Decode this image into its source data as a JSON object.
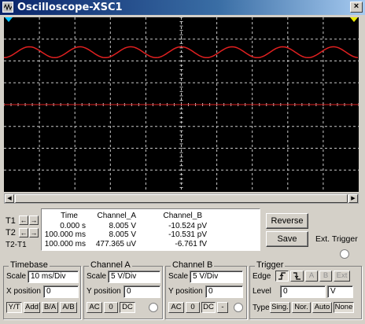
{
  "window": {
    "title": "Oscilloscope-XSC1",
    "close_label": "×"
  },
  "colors": {
    "trace_a": "#e02020",
    "grid": "#c8c8c8",
    "cursor_t1": "#00c0ff",
    "cursor_t2": "#e8e800"
  },
  "scope": {
    "sine": {
      "cycles_visible": 7,
      "amplitude_div": 0.25,
      "offset_div": 2.4
    },
    "baseline": {
      "offset_div": 0
    }
  },
  "cursors": {
    "t1_label": "T1",
    "t2_label": "T2",
    "diff_label": "T2-T1",
    "arrow_left": "←",
    "arrow_right": "→"
  },
  "readout": {
    "headers": [
      "Time",
      "Channel_A",
      "Channel_B"
    ],
    "rows": [
      [
        "0.000 s",
        "8.005 V",
        "-10.524 pV"
      ],
      [
        "100.000 ms",
        "8.005 V",
        "-10.531 pV"
      ],
      [
        "100.000 ms",
        "477.365 uV",
        "-6.761 fV"
      ]
    ]
  },
  "buttons": {
    "reverse": "Reverse",
    "save": "Save",
    "ext_trigger": "Ext. Trigger"
  },
  "timebase": {
    "title": "Timebase",
    "scale_label": "Scale",
    "scale_value": "10 ms/Div",
    "xpos_label": "X position",
    "xpos_value": "0",
    "modes": [
      "Y/T",
      "Add",
      "B/A",
      "A/B"
    ]
  },
  "channel_a": {
    "title": "Channel A",
    "scale_label": "Scale",
    "scale_value": "5  V/Div",
    "ypos_label": "Y position",
    "ypos_value": "0",
    "coupling": [
      "AC",
      "0",
      "DC"
    ]
  },
  "channel_b": {
    "title": "Channel B",
    "scale_label": "Scale",
    "scale_value": "5  V/Div",
    "ypos_label": "Y position",
    "ypos_value": "0",
    "coupling": [
      "AC",
      "0",
      "DC",
      "-"
    ]
  },
  "trigger": {
    "title": "Trigger",
    "edge_label": "Edge",
    "edge_buttons": [
      "A",
      "B",
      "Ext"
    ],
    "level_label": "Level",
    "level_value": "0",
    "level_unit": "V",
    "type_label": "Type",
    "types": [
      "Sing.",
      "Nor.",
      "Auto",
      "None"
    ]
  }
}
